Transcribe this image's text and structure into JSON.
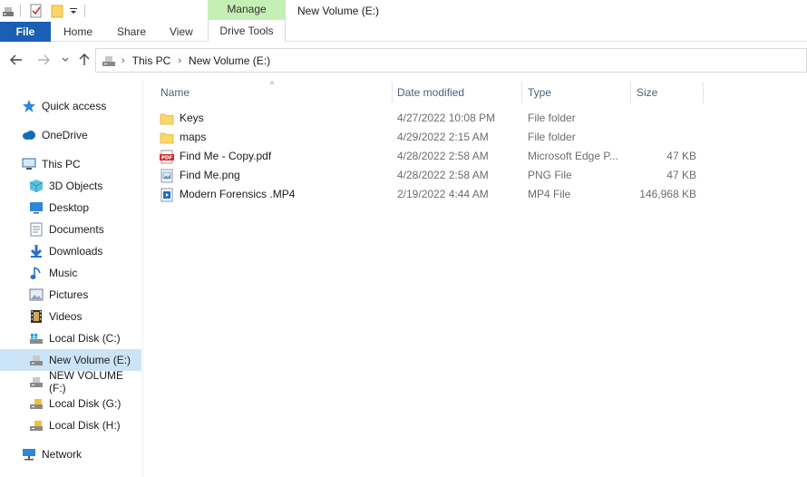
{
  "window": {
    "title": "New Volume (E:)"
  },
  "ribbon": {
    "context_tab": "Manage",
    "context_subtab": "Drive Tools",
    "tabs": [
      "File",
      "Home",
      "Share",
      "View"
    ]
  },
  "address": {
    "crumbs": [
      "This PC",
      "New Volume (E:)"
    ]
  },
  "sidebar": {
    "items": [
      {
        "label": "Quick access",
        "icon": "star-icon"
      },
      {
        "label": "OneDrive",
        "icon": "cloud-icon"
      },
      {
        "label": "This PC",
        "icon": "computer-icon"
      },
      {
        "label": "3D Objects",
        "icon": "cube-icon"
      },
      {
        "label": "Desktop",
        "icon": "desktop-icon"
      },
      {
        "label": "Documents",
        "icon": "document-icon"
      },
      {
        "label": "Downloads",
        "icon": "download-icon"
      },
      {
        "label": "Music",
        "icon": "music-icon"
      },
      {
        "label": "Pictures",
        "icon": "picture-icon"
      },
      {
        "label": "Videos",
        "icon": "video-icon"
      },
      {
        "label": "Local Disk (C:)",
        "icon": "drive-icon"
      },
      {
        "label": "New Volume (E:)",
        "icon": "drive-icon"
      },
      {
        "label": "NEW VOLUME (F:)",
        "icon": "drive-icon"
      },
      {
        "label": "Local Disk (G:)",
        "icon": "drive-icon"
      },
      {
        "label": "Local Disk (H:)",
        "icon": "drive-icon"
      },
      {
        "label": "Network",
        "icon": "network-icon"
      }
    ]
  },
  "columns": {
    "name": "Name",
    "date": "Date modified",
    "type": "Type",
    "size": "Size"
  },
  "files": [
    {
      "name": "Keys",
      "date": "4/27/2022 10:08 PM",
      "type": "File folder",
      "size": "",
      "icon": "folder-icon"
    },
    {
      "name": "maps",
      "date": "4/29/2022 2:15 AM",
      "type": "File folder",
      "size": "",
      "icon": "folder-icon"
    },
    {
      "name": "Find Me - Copy.pdf",
      "date": "4/28/2022 2:58 AM",
      "type": "Microsoft Edge P...",
      "size": "47 KB",
      "icon": "pdf-icon"
    },
    {
      "name": "Find Me.png",
      "date": "4/28/2022 2:58 AM",
      "type": "PNG File",
      "size": "47 KB",
      "icon": "image-file-icon"
    },
    {
      "name": "Modern Forensics .MP4",
      "date": "2/19/2022 4:44 AM",
      "type": "MP4 File",
      "size": "146,968 KB",
      "icon": "video-file-icon"
    }
  ],
  "colors": {
    "accent": "#1a5fb4",
    "manage": "#c6efb5",
    "selected": "#cce4f7"
  }
}
